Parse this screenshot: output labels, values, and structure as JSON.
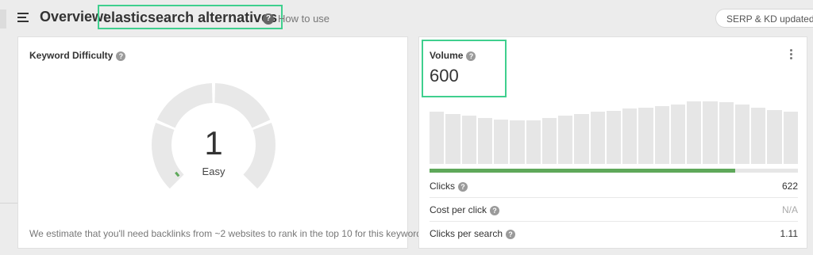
{
  "header": {
    "title_prefix": "Overview:",
    "keyword": "elasticsearch alternatives",
    "how_to_use": "How to use",
    "serp_badge": "SERP & KD updated"
  },
  "keyword_difficulty": {
    "title": "Keyword Difficulty",
    "score": "1",
    "score_value": 1,
    "label": "Easy",
    "footnote": "We estimate that you'll need backlinks from ~2 websites to rank in the top 10 for this keyword",
    "track_color": "#e8e8e8",
    "fill_color": "#5ea85a"
  },
  "volume": {
    "title": "Volume",
    "value": "600",
    "history_bars": [
      0.8,
      0.77,
      0.74,
      0.71,
      0.68,
      0.67,
      0.67,
      0.71,
      0.74,
      0.77,
      0.8,
      0.82,
      0.85,
      0.87,
      0.89,
      0.91,
      0.96,
      0.96,
      0.95,
      0.92,
      0.87,
      0.83,
      0.8
    ],
    "bar_color": "#e6e6e6",
    "clicks_ratio": 0.83,
    "progress_color": "#5ea85a",
    "metrics": [
      {
        "label": "Clicks",
        "value": "622"
      },
      {
        "label": "Cost per click",
        "value": "N/A"
      },
      {
        "label": "Clicks per search",
        "value": "1.11"
      }
    ]
  },
  "colors": {
    "highlight": "#3fcf8e",
    "background": "#ececec"
  }
}
